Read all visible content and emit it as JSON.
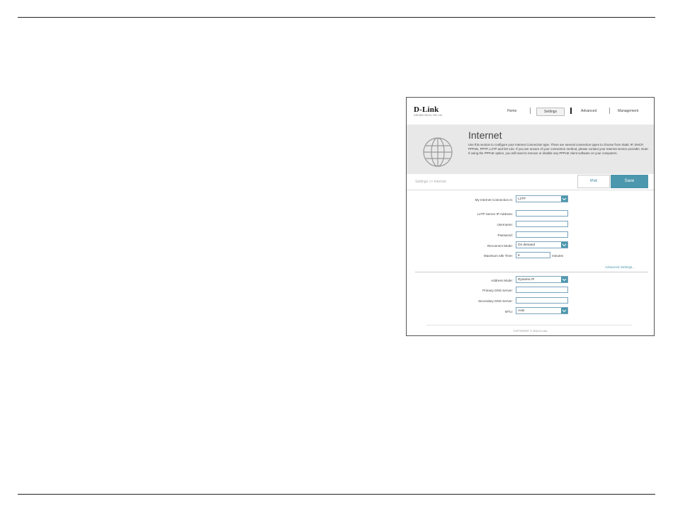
{
  "brand": {
    "logo": "D-Link",
    "model": "DIR-859   HW:A1   FW:1.00"
  },
  "nav": {
    "home": "Home",
    "settings": "Settings",
    "advanced": "Advanced",
    "management": "Management"
  },
  "banner": {
    "title": "Internet",
    "description": "Use this section to configure your Internet Connection type. There are several connection types to choose from Static IP, DHCP, PPPoE, PPTP, L2TP and DS-Lite. If you are unsure of your connection method, please contact your Internet service provider. Note: If using the PPPoE option, you will need to remove or disable any PPPoE client software on your computers."
  },
  "toolbar": {
    "breadcrumb": "Settings >> Internet",
    "ipv6_label": "IPv6",
    "save_label": "Save"
  },
  "form": {
    "connection": {
      "label": "My Internet Connection is:",
      "value": "L2TP"
    },
    "l2tp_server": {
      "label": "L2TP Server IP Address:",
      "value": ""
    },
    "username": {
      "label": "Username:",
      "value": ""
    },
    "password": {
      "label": "Password:",
      "value": ""
    },
    "reconnect": {
      "label": "Reconnect Mode:",
      "value": "On demand"
    },
    "idle_time": {
      "label": "Maximum Idle Time:",
      "value": "5",
      "unit": "minutes"
    },
    "advanced_link": "Advanced Settings...",
    "address_mode": {
      "label": "Address Mode:",
      "value": "Dynamic IP"
    },
    "primary_dns": {
      "label": "Primary DNS Server:",
      "value": ""
    },
    "secondary_dns": {
      "label": "Secondary DNS Server:",
      "value": ""
    },
    "mtu": {
      "label": "MTU:",
      "value": "Auto"
    }
  },
  "footer": {
    "copyright": "COPYRIGHT © 2014 D-Link"
  },
  "colors": {
    "accent": "#4b97ad",
    "banner_bg": "#e8e8e8",
    "field_border": "#7aa3bd"
  }
}
